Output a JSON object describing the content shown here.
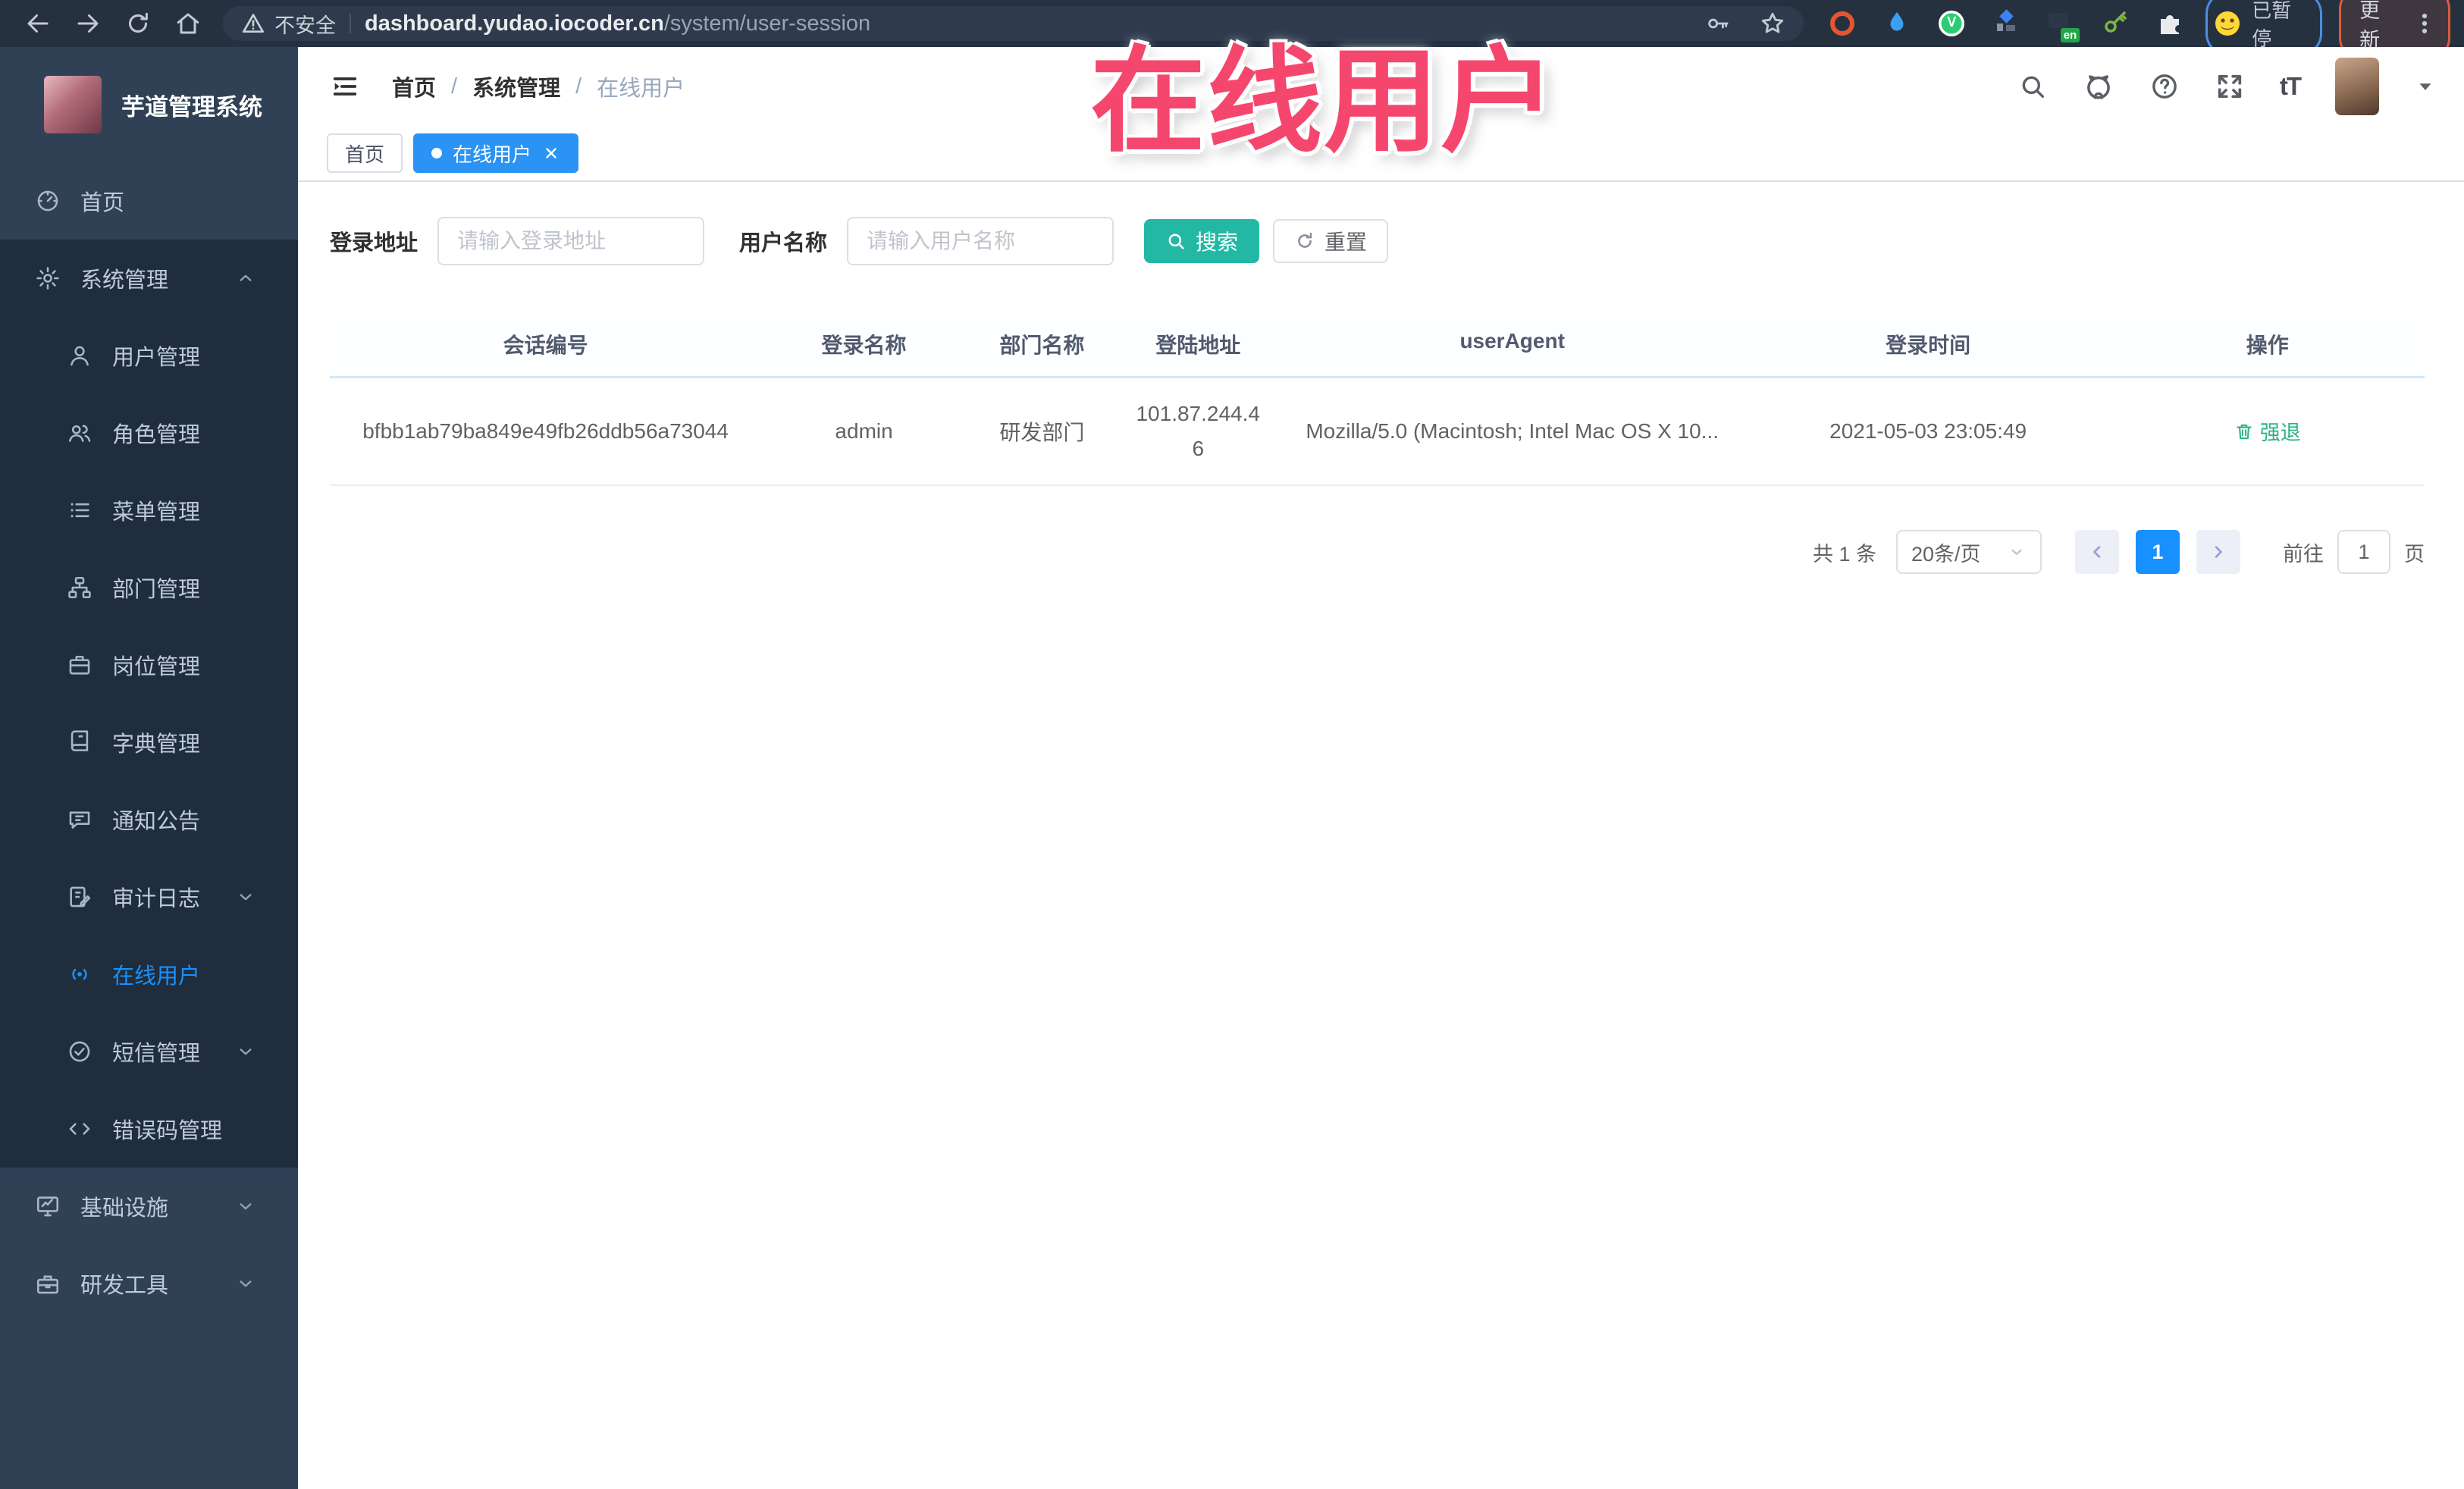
{
  "browser": {
    "security_label": "不安全",
    "url_domain": "dashboard.yudao.iocoder.cn",
    "url_path": "/system/user-session",
    "ext_v_label": "V",
    "ext_en_label": "en",
    "paused_label": "已暂停",
    "update_label": "更新"
  },
  "overlay_title": "在线用户",
  "sidebar": {
    "logo_title": "芋道管理系统",
    "items": [
      {
        "label": "首页"
      },
      {
        "label": "系统管理"
      },
      {
        "label": "用户管理"
      },
      {
        "label": "角色管理"
      },
      {
        "label": "菜单管理"
      },
      {
        "label": "部门管理"
      },
      {
        "label": "岗位管理"
      },
      {
        "label": "字典管理"
      },
      {
        "label": "通知公告"
      },
      {
        "label": "审计日志"
      },
      {
        "label": "在线用户"
      },
      {
        "label": "短信管理"
      },
      {
        "label": "错误码管理"
      },
      {
        "label": "基础设施"
      },
      {
        "label": "研发工具"
      }
    ]
  },
  "header": {
    "breadcrumb": [
      "首页",
      "系统管理",
      "在线用户"
    ],
    "font_size_icon_label": "tT"
  },
  "tags": {
    "home": "首页",
    "active": "在线用户"
  },
  "filter": {
    "address_label": "登录地址",
    "address_placeholder": "请输入登录地址",
    "username_label": "用户名称",
    "username_placeholder": "请输入用户名称",
    "search_label": "搜索",
    "reset_label": "重置"
  },
  "table": {
    "columns": [
      "会话编号",
      "登录名称",
      "部门名称",
      "登陆地址",
      "userAgent",
      "登录时间",
      "操作"
    ],
    "rows": [
      {
        "session_id": "bfbb1ab79ba849e49fb26ddb56a73044",
        "username": "admin",
        "dept": "研发部门",
        "ip": "101.87.244.46",
        "user_agent": "Mozilla/5.0 (Macintosh; Intel Mac OS X 10...",
        "login_time": "2021-05-03 23:05:49",
        "action_label": "强退"
      }
    ]
  },
  "pagination": {
    "total_label": "共 1 条",
    "page_size_label": "20条/页",
    "current_page": "1",
    "goto_label": "前往",
    "goto_value": "1",
    "unit_label": "页"
  },
  "colors": {
    "primary": "#1890ff",
    "tab_active": "#2a93f4",
    "search_button": "#23b8a4",
    "action_link": "#2ab388",
    "overlay_red": "#f5476d",
    "sidebar_bg": "#304156",
    "submenu_bg": "#1f2d3d",
    "chrome_bg": "#263140"
  }
}
